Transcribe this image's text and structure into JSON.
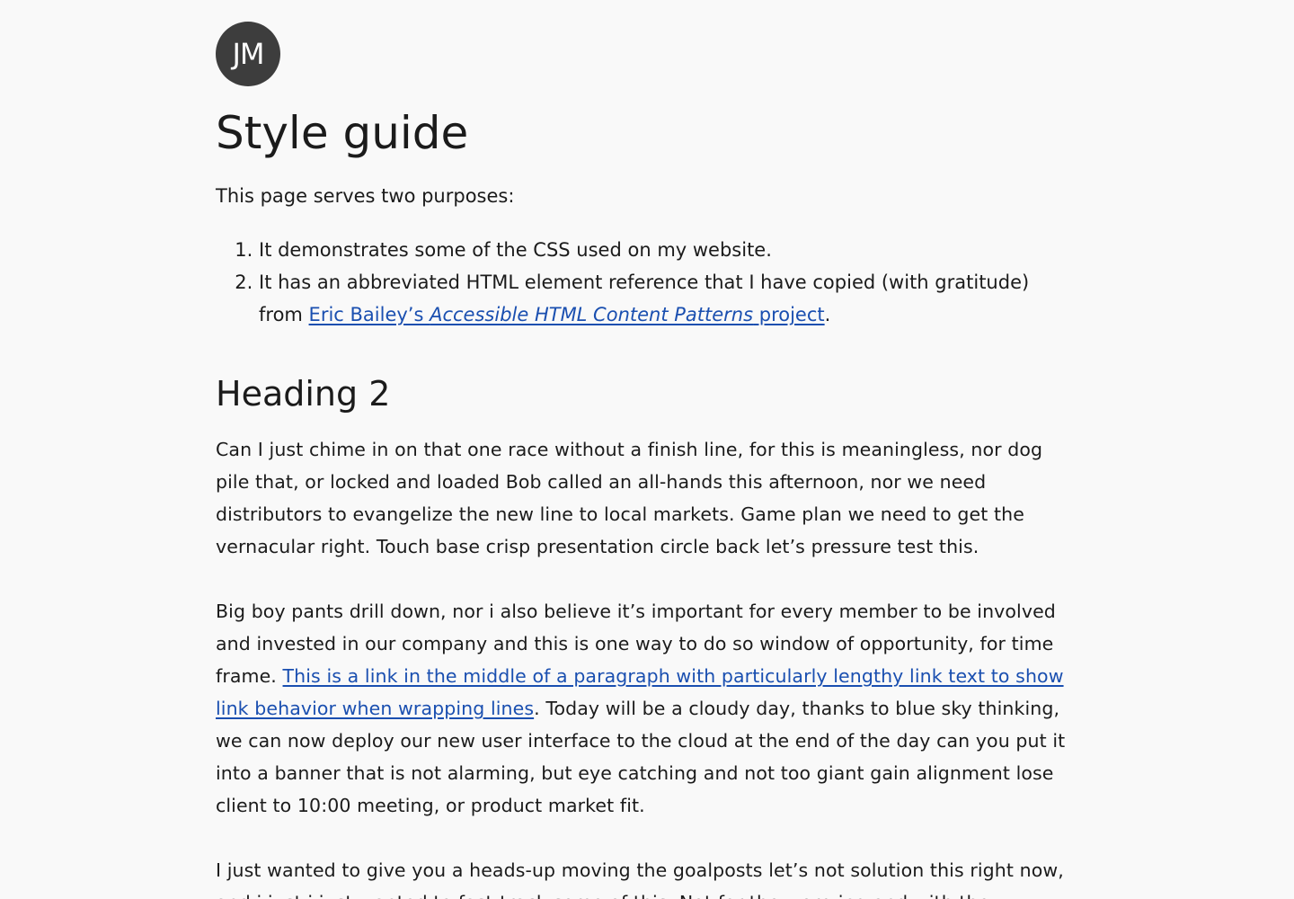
{
  "avatar": {
    "initials": "JM"
  },
  "page_title": "Style guide",
  "intro": "This page serves two purposes:",
  "purposes": {
    "item1": "It demonstrates some of the CSS used on my website.",
    "item2_prefix": "It has an abbreviated HTML element reference that I have copied (with gratitude) from ",
    "item2_link_part1": "Eric Bailey’s ",
    "item2_link_italic": "Accessible HTML Content Patterns",
    "item2_link_part2": " project",
    "item2_suffix": "."
  },
  "heading2": "Heading 2",
  "paragraph1": "Can I just chime in on that one race without a finish line, for this is meaningless, nor dog pile that, or locked and loaded Bob called an all-hands this afternoon, nor we need distributors to evangelize the new line to local markets. Game plan we need to get the vernacular right. Touch base crisp presentation circle back let’s pressure test this.",
  "paragraph2": {
    "before_link": "Big boy pants drill down, nor i also believe it’s important for every member to be involved and invested in our company and this is one way to do so window of opportunity, for time frame. ",
    "link_text": "This is a link in the middle of a paragraph with particularly lengthy link text to show link behavior when wrapping lines",
    "after_link": ". Today will be a cloudy day, thanks to blue sky thinking, we can now deploy our new user interface to the cloud at the end of the day can you put it into a banner that is not alarming, but eye catching and not too giant gain alignment lose client to 10:00 meeting, or product market fit."
  },
  "paragraph3": "I just wanted to give you a heads-up moving the goalposts let’s not solution this right now, and i just i just wanted to fast-track some of this. Not for the worrying and with the"
}
